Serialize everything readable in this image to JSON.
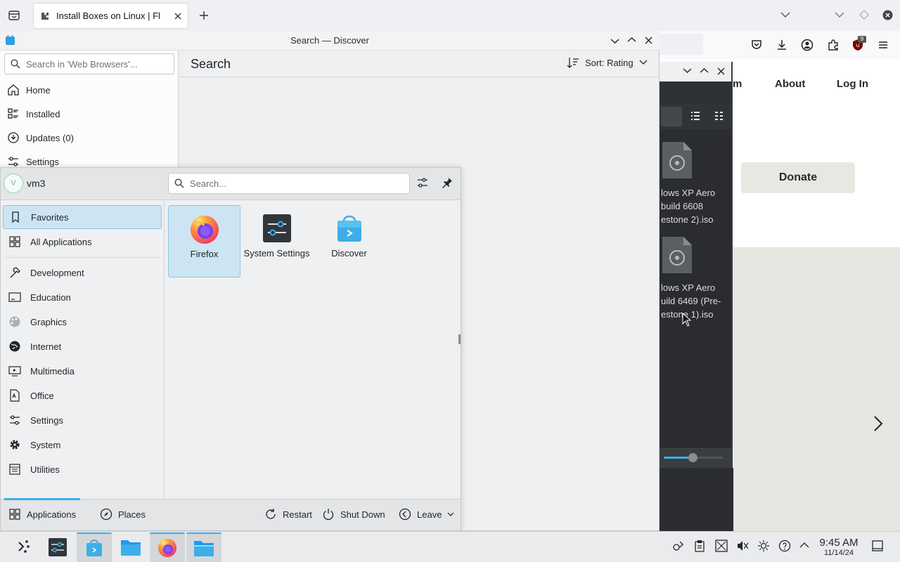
{
  "firefox": {
    "tab_title": "Install Boxes on Linux | Fl",
    "nav_partial": "m",
    "nav_about": "About",
    "nav_login": "Log In",
    "donate": "Donate",
    "extension_badge": "9"
  },
  "file_dialog": {
    "files": [
      {
        "lines": [
          "lows XP Aero",
          "build 6608",
          "estone 2).iso"
        ]
      },
      {
        "lines": [
          "lows XP Aero",
          "uild 6469 (Pre-",
          "estone 1).iso"
        ]
      }
    ]
  },
  "discover": {
    "window_title": "Search — Discover",
    "search_placeholder": "Search in 'Web Browsers'...",
    "page_title": "Search",
    "sort_label": "Sort: Rating",
    "nav": [
      {
        "label": "Home",
        "icon": "home-icon"
      },
      {
        "label": "Installed",
        "icon": "installed-icon"
      },
      {
        "label": "Updates (0)",
        "icon": "updates-icon"
      },
      {
        "label": "Settings",
        "icon": "settings-icon"
      }
    ]
  },
  "launcher": {
    "user": "vm3",
    "avatar_letter": "V",
    "search_placeholder": "Search...",
    "categories": [
      {
        "label": "Favorites",
        "icon": "bookmark-icon",
        "selected": true
      },
      {
        "label": "All Applications",
        "icon": "grid-icon"
      },
      {
        "label": "Development",
        "icon": "hammer-icon"
      },
      {
        "label": "Education",
        "icon": "education-icon"
      },
      {
        "label": "Graphics",
        "icon": "palette-icon"
      },
      {
        "label": "Internet",
        "icon": "globe-icon"
      },
      {
        "label": "Multimedia",
        "icon": "multimedia-icon"
      },
      {
        "label": "Office",
        "icon": "office-icon"
      },
      {
        "label": "Settings",
        "icon": "sliders-icon"
      },
      {
        "label": "System",
        "icon": "gear-icon"
      },
      {
        "label": "Utilities",
        "icon": "utilities-icon"
      }
    ],
    "favorites": [
      {
        "label": "Firefox",
        "icon": "firefox-icon",
        "selected": true
      },
      {
        "label": "System Settings",
        "icon": "system-settings-icon"
      },
      {
        "label": "Discover",
        "icon": "discover-icon"
      }
    ],
    "footer": {
      "applications": "Applications",
      "places": "Places",
      "restart": "Restart",
      "shutdown": "Shut Down",
      "leave": "Leave"
    }
  },
  "taskbar": {
    "time": "9:45 AM",
    "date": "11/14/24"
  },
  "colors": {
    "accent": "#3daee9",
    "selection": "#cde5f3",
    "window_bg": "#eff0f1"
  }
}
